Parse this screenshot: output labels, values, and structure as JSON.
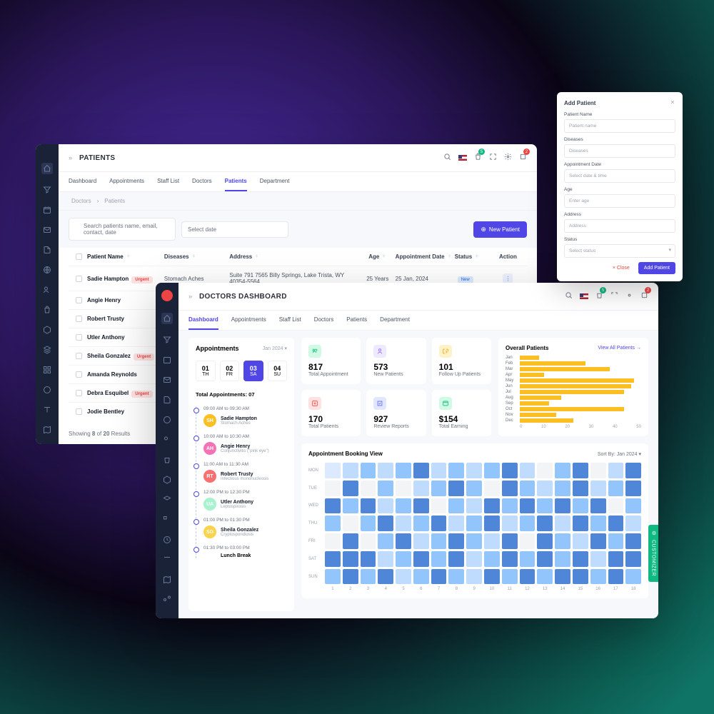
{
  "patients": {
    "title": "PATIENTS",
    "tabs": [
      "Dashboard",
      "Appointments",
      "Staff List",
      "Doctors",
      "Patients",
      "Department"
    ],
    "active_tab": "Patients",
    "breadcrumb": [
      "Doctors",
      "Patients"
    ],
    "search_placeholder": "Search patients name, email, contact, date",
    "date_placeholder": "Select date",
    "new_patient_btn": "New Patient",
    "cols": [
      "Patient Name",
      "Diseases",
      "Address",
      "Age",
      "Appointment Date",
      "Status",
      "Action"
    ],
    "rows": [
      {
        "name": "Sadie Hampton",
        "tag": "Urgent",
        "disease": "Stomach Aches",
        "address": "Suite 791 7565 Billy Springs, Lake Trista, WY 40354-5564",
        "age": "25 Years",
        "date": "25 Jan, 2024",
        "status": "New"
      },
      {
        "name": "Angie Henry",
        "tag": "",
        "disease": "",
        "address": "",
        "age": "",
        "date": "",
        "status": ""
      },
      {
        "name": "Robert Trusty",
        "tag": "",
        "disease": "",
        "address": "",
        "age": "",
        "date": "",
        "status": ""
      },
      {
        "name": "Utler Anthony",
        "tag": "",
        "disease": "",
        "address": "",
        "age": "",
        "date": "",
        "status": ""
      },
      {
        "name": "Sheila Gonzalez",
        "tag": "Urgent",
        "disease": "",
        "address": "",
        "age": "",
        "date": "",
        "status": ""
      },
      {
        "name": "Amanda Reynolds",
        "tag": "",
        "disease": "",
        "address": "",
        "age": "",
        "date": "",
        "status": ""
      },
      {
        "name": "Debra Esquibel",
        "tag": "Urgent",
        "disease": "",
        "address": "",
        "age": "",
        "date": "",
        "status": ""
      },
      {
        "name": "Jodie Bentley",
        "tag": "",
        "disease": "",
        "address": "",
        "age": "",
        "date": "",
        "status": ""
      }
    ],
    "results_text_pre": "Showing ",
    "results_a": "8",
    "results_mid": " of ",
    "results_b": "20",
    "results_post": " Results",
    "badge_cart": "5",
    "badge_notif": "2"
  },
  "dash": {
    "title": "DOCTORS DASHBOARD",
    "tabs": [
      "Dashboard",
      "Appointments",
      "Staff List",
      "Doctors",
      "Patients",
      "Department"
    ],
    "active_tab": "Dashboard",
    "appointments_lbl": "Appointments",
    "month_sel": "Jan 2024",
    "dates": [
      {
        "n": "01",
        "d": "TH"
      },
      {
        "n": "02",
        "d": "FR"
      },
      {
        "n": "03",
        "d": "SA"
      },
      {
        "n": "04",
        "d": "SU"
      }
    ],
    "active_date": 2,
    "total_apt": "Total Appointments: 07",
    "slots": [
      {
        "time": "09:00 AM to 09:30 AM",
        "name": "Sadie Hampton",
        "dis": "Stomach Aches",
        "initials": "SH",
        "bg": "#fbbf24"
      },
      {
        "time": "10:00 AM to 10:30 AM",
        "name": "Angie Henry",
        "dis": "Conjunctivitis (\"pink eye\")",
        "initials": "AH",
        "bg": "#f472b6"
      },
      {
        "time": "11:00 AM to 11:30 AM",
        "name": "Robert Trusty",
        "dis": "Infectious mononucleosis",
        "initials": "RT",
        "bg": "#f87171"
      },
      {
        "time": "12:00 PM to 12:30 PM",
        "name": "Utler Anthony",
        "dis": "Leptospirosis",
        "initials": "UA",
        "bg": "#a7f3d0"
      },
      {
        "time": "01:00 PM to 01:30 PM",
        "name": "Sheila Gonzalez",
        "dis": "Cryptosporidiosis",
        "initials": "SG",
        "bg": "#fcd34d"
      },
      {
        "time": "01:30 PM to 03:00 PM",
        "name": "Lunch Break",
        "dis": "",
        "initials": "",
        "bg": ""
      }
    ],
    "stats": [
      {
        "num": "817",
        "lbl": "Total Appointment",
        "bg": "#d1fae5",
        "color": "#10b981"
      },
      {
        "num": "573",
        "lbl": "New Patients",
        "bg": "#ede9fe",
        "color": "#8b5cf6"
      },
      {
        "num": "101",
        "lbl": "Follow Up Patients",
        "bg": "#fef3c7",
        "color": "#f59e0b"
      },
      {
        "num": "170",
        "lbl": "Total Patients",
        "bg": "#fee2e2",
        "color": "#ef4444"
      },
      {
        "num": "927",
        "lbl": "Review Reports",
        "bg": "#e0e7ff",
        "color": "#6366f1"
      },
      {
        "num": "$154",
        "lbl": "Total Earning",
        "bg": "#d1fae5",
        "color": "#10b981"
      }
    ],
    "chart_title": "Overall Patients",
    "chart_link": "View All Patients →",
    "heatmap_title": "Appointment Booking View",
    "heatmap_sort": "Sort By:  Jan 2024",
    "heatmap_days": [
      "MON",
      "TUE",
      "WED",
      "THU",
      "FRI",
      "SAT",
      "SUN"
    ],
    "badge_cart": "5",
    "badge_notif": "2"
  },
  "modal": {
    "title": "Add Patient",
    "fields": [
      {
        "label": "Patient Name",
        "placeholder": "Patient name"
      },
      {
        "label": "Diseases",
        "placeholder": "Diseases"
      },
      {
        "label": "Appointment Date",
        "placeholder": "Select date & time"
      },
      {
        "label": "Age",
        "placeholder": "Enter age"
      },
      {
        "label": "Address",
        "placeholder": "Address"
      },
      {
        "label": "Status",
        "placeholder": "Select status",
        "select": true
      }
    ],
    "close_btn": "× Close",
    "add_btn": "Add Patient"
  },
  "customizer": "CUSTOMIZER",
  "chart_data": {
    "type": "bar",
    "orientation": "horizontal",
    "categories": [
      "Jan",
      "Feb",
      "Mar",
      "Apr",
      "May",
      "Jun",
      "Jul",
      "Aug",
      "Sep",
      "Oct",
      "Nov",
      "Dec"
    ],
    "values": [
      8,
      27,
      37,
      10,
      47,
      46,
      43,
      17,
      12,
      43,
      15,
      22
    ],
    "title": "Overall Patients",
    "xlim": [
      0,
      50
    ],
    "xticks": [
      0,
      10,
      20,
      30,
      40,
      50
    ]
  },
  "heatmap_data": {
    "type": "heatmap",
    "rows": [
      "MON",
      "TUE",
      "WED",
      "THU",
      "FRI",
      "SAT",
      "SUN"
    ],
    "cols": [
      1,
      2,
      3,
      4,
      5,
      6,
      7,
      8,
      9,
      10,
      11,
      12,
      13,
      14,
      15,
      16,
      17,
      18
    ],
    "values": [
      [
        1,
        2,
        3,
        2,
        3,
        4,
        2,
        3,
        2,
        3,
        4,
        2,
        0,
        3,
        4,
        0,
        2,
        4
      ],
      [
        0,
        4,
        0,
        3,
        0,
        2,
        3,
        4,
        3,
        0,
        4,
        3,
        2,
        3,
        4,
        2,
        3,
        4
      ],
      [
        4,
        3,
        4,
        2,
        3,
        4,
        0,
        3,
        2,
        4,
        3,
        4,
        3,
        4,
        3,
        4,
        0,
        3
      ],
      [
        3,
        0,
        3,
        4,
        2,
        3,
        4,
        2,
        3,
        4,
        2,
        3,
        4,
        2,
        4,
        3,
        4,
        2
      ],
      [
        0,
        4,
        0,
        3,
        4,
        2,
        3,
        4,
        3,
        2,
        4,
        0,
        4,
        3,
        2,
        4,
        3,
        4
      ],
      [
        4,
        4,
        4,
        2,
        3,
        4,
        3,
        4,
        2,
        3,
        4,
        3,
        4,
        3,
        4,
        2,
        4,
        4
      ],
      [
        3,
        4,
        3,
        4,
        2,
        3,
        4,
        3,
        2,
        4,
        3,
        4,
        3,
        4,
        4,
        3,
        4,
        3
      ]
    ],
    "scale": {
      "0": "#f3f4f6",
      "1": "#dbeafe",
      "2": "#bfdbfe",
      "3": "#93c5fd",
      "4": "#4f86d8"
    }
  }
}
